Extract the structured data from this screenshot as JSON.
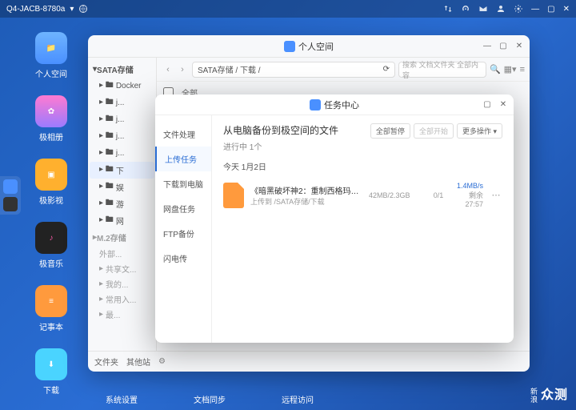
{
  "topbar": {
    "host": "Q4-JACB-8780a"
  },
  "desktop": [
    {
      "label": "个人空间",
      "color": "#4a90ff"
    },
    {
      "label": "极相册",
      "color": "linear-gradient(#ff7ad1,#9a7bff)"
    },
    {
      "label": "极影视",
      "color": "#ffb02e"
    },
    {
      "label": "极音乐",
      "color": "#222"
    },
    {
      "label": "记事本",
      "color": "#ff9a3d"
    },
    {
      "label": "下载",
      "color": "#4ad4ff"
    }
  ],
  "bottom": [
    "系统设置",
    "文档同步",
    "远程访问"
  ],
  "filemgr": {
    "title": "个人空间",
    "path": "SATA存储 / 下载 /",
    "search_ph": "搜索 文档文件夹 全部内容",
    "tree_header": "SATA存储",
    "tree": [
      "Docker",
      "j...",
      "j...",
      "j...",
      "j...",
      "下",
      "娱",
      "游",
      "网"
    ],
    "tree2_header": "M.2存储",
    "tree2": [
      "外部...",
      "共享文...",
      "我的...",
      "常用入...",
      "最..."
    ],
    "footer": [
      "文件夹",
      "其他站"
    ],
    "sel_label": "全部"
  },
  "taskcenter": {
    "title": "任务中心",
    "side": [
      "文件处理",
      "上传任务",
      "下载到电脑",
      "网盘任务",
      "FTP备份",
      "闪电传"
    ],
    "active": 1,
    "heading": "从电脑备份到极空间的文件",
    "progress": "进行中 1个",
    "actions": [
      "全部暂停",
      "全部开始",
      "更多操作"
    ],
    "date": "今天 1月2日",
    "task": {
      "name": "《暗黑破坏神2：重制西格玛2.51 MEDIAN...",
      "path": "上传到 /SATA存储/下载",
      "size": "42MB/2.3GB",
      "count": "0/1",
      "speed": "1.4MB/s",
      "remain": "剩余27:57"
    }
  },
  "watermark": {
    "small": "新浪",
    "big": "众测"
  }
}
